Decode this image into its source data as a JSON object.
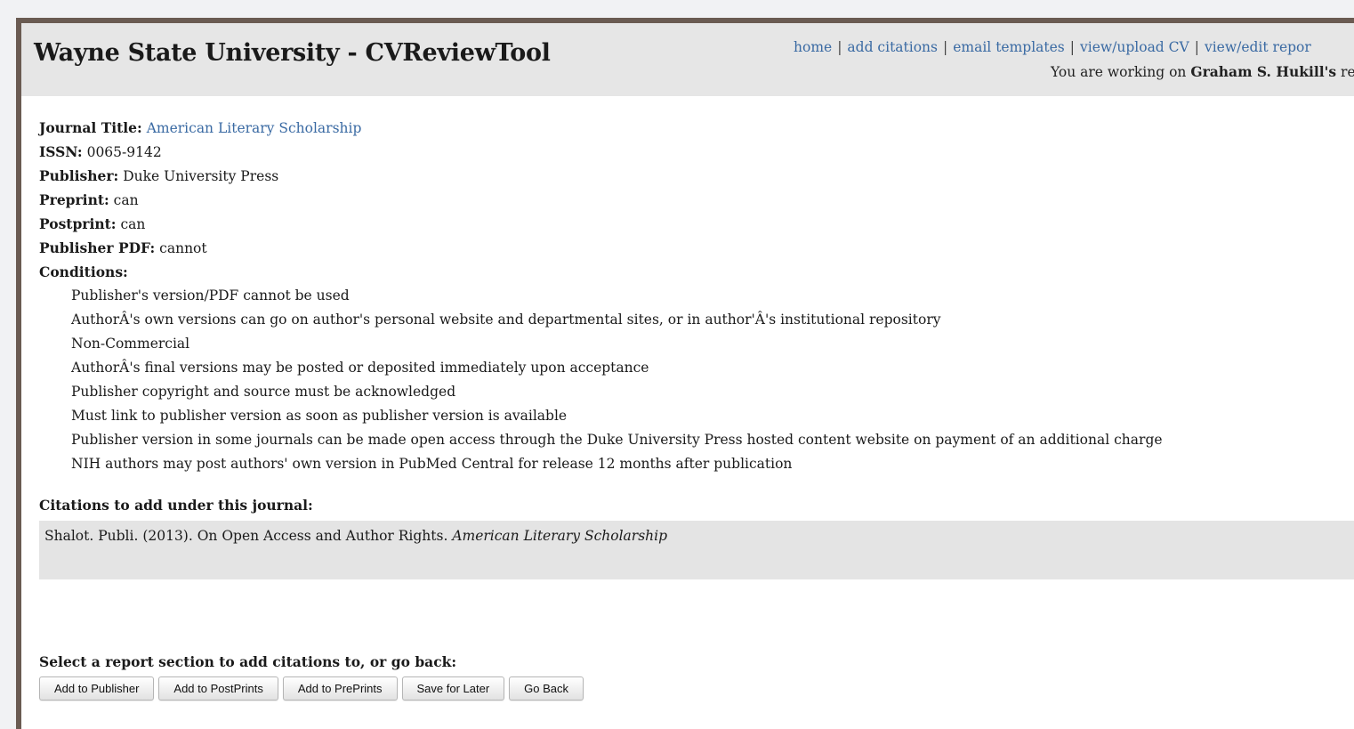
{
  "header": {
    "title": "Wayne State University - CVReviewTool",
    "nav": [
      "home",
      "add citations",
      "email templates",
      "view/upload CV",
      "view/edit repor"
    ],
    "working_prefix": "You are working on",
    "working_name": "Graham S. Hukill's",
    "working_suffix": "repor"
  },
  "journal": {
    "title_label": "Journal Title:",
    "title_value": "American Literary Scholarship",
    "issn_label": "ISSN:",
    "issn_value": "0065-9142",
    "publisher_label": "Publisher:",
    "publisher_value": "Duke University Press",
    "preprint_label": "Preprint:",
    "preprint_value": "can",
    "postprint_label": "Postprint:",
    "postprint_value": "can",
    "pdf_label": "Publisher PDF:",
    "pdf_value": "cannot",
    "conditions_label": "Conditions:",
    "conditions": [
      "Publisher's version/PDF cannot be used",
      "AuthorÂ's own versions can go on author's personal website and departmental sites, or in author'Â's institutional repository",
      "Non-Commercial",
      "AuthorÂ's final versions may be posted or deposited immediately upon acceptance",
      "Publisher copyright and source must be acknowledged",
      "Must link to publisher version as soon as publisher version is available",
      "Publisher version in some journals can be made open access through the Duke University Press hosted content website on payment of an additional charge",
      "NIH authors may post authors' own version in PubMed Central for release 12 months after publication"
    ]
  },
  "citations": {
    "heading": "Citations to add under this journal:",
    "entry_text": "Shalot. Publi. (2013). On Open Access and Author Rights.",
    "entry_journal": "American Literary Scholarship"
  },
  "actions": {
    "heading": "Select a report section to add citations to, or go back:",
    "add_publisher": "Add to Publisher",
    "add_postprints": "Add to PostPrints",
    "add_preprints": "Add to PrePrints",
    "save_later": "Save for Later",
    "go_back": "Go Back"
  }
}
